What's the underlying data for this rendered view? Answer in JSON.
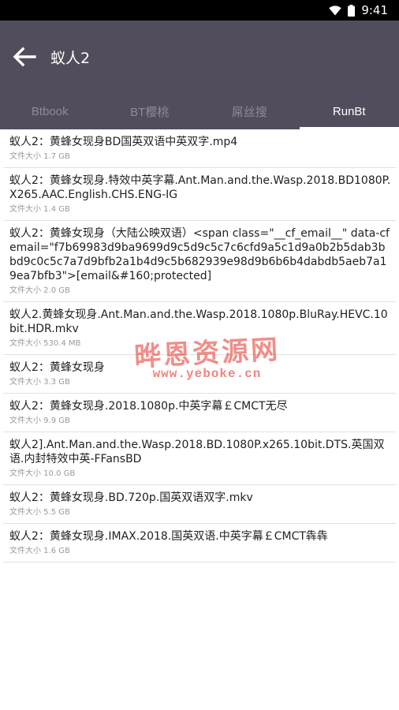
{
  "status": {
    "time": "9:41"
  },
  "toolbar": {
    "title": "蚁人2"
  },
  "tabs": [
    {
      "label": "Btbook",
      "active": false
    },
    {
      "label": "BT樱桃",
      "active": false
    },
    {
      "label": "屌丝搜",
      "active": false
    },
    {
      "label": "RunBt",
      "active": true
    }
  ],
  "results": [
    {
      "title": "蚁人2：黄蜂女现身BD国英双语中英双字.mp4",
      "size": "文件大小 1.7 GB"
    },
    {
      "title": "蚁人2：黄蜂女现身.特效中英字幕.Ant.Man.and.the.Wasp.2018.BD1080P.X265.AAC.English.CHS.ENG-IG",
      "size": "文件大小 1.4 GB"
    },
    {
      "title": "蚁人2：黄蜂女现身（大陆公映双语）<span class=\"__cf_email__\" data-cfemail=\"f7b69983d9ba9699d9c5d9c5c7c6cfd9a5c1d9a0b2b5dab3bbd9c0c5c7a7d9bfb2a1b4d9c5b682939e98d9b6b6b4dabdb5aeb7a19ea7bfb3\">[email&#160;protected]",
      "size": "文件大小 2.0 GB"
    },
    {
      "title": "蚁人2.黄蜂女现身.Ant.Man.and.the.Wasp.2018.1080p.BluRay.HEVC.10bit.HDR.mkv",
      "size": "文件大小 530.4 MB"
    },
    {
      "title": "蚁人2：黄蜂女现身",
      "size": "文件大小 3.3 GB"
    },
    {
      "title": "蚁人2：黄蜂女现身.2018.1080p.中英字幕￡CMCT无尽",
      "size": "文件大小 9.9 GB"
    },
    {
      "title": "蚁人2].Ant.Man.and.the.Wasp.2018.BD.1080P.x265.10bit.DTS.英国双语.内封特效中英-FFansBD",
      "size": "文件大小 10.0 GB"
    },
    {
      "title": "蚁人2：黄蜂女现身.BD.720p.国英双语双字.mkv",
      "size": "文件大小 5.5 GB"
    },
    {
      "title": "蚁人2：黄蜂女现身.IMAX.2018.国英双语.中英字幕￡CMCT犇犇",
      "size": "文件大小 1.6 GB"
    }
  ],
  "watermark": {
    "main": "晔恩资源网",
    "sub": "www.yeboke.cn"
  }
}
